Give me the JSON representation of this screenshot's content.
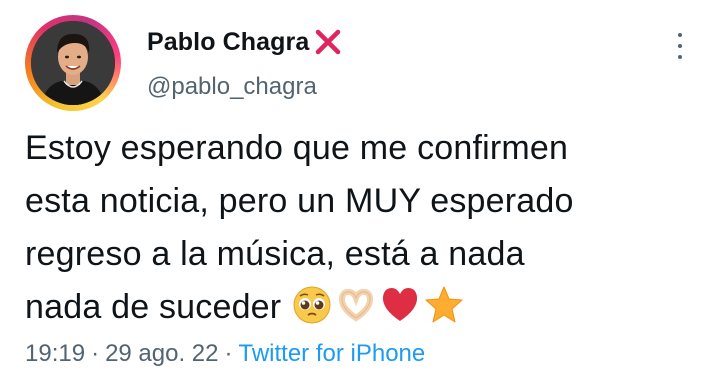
{
  "author": {
    "display_name": "Pablo Chagra",
    "handle": "@pablo_chagra",
    "badge_icon": "red-x-icon",
    "avatar_ring_colors": [
      "#f4c430",
      "#f57c1f",
      "#e1306c",
      "#c13584"
    ]
  },
  "tweet": {
    "lines": [
      "Estoy esperando que me confirmen",
      "esta noticia, pero un MUY esperado",
      "regreso a la música, está a nada",
      "nada de suceder"
    ],
    "emojis": [
      "pleading-face-emoji",
      "heart-hands-emoji",
      "red-heart-emoji",
      "star-emoji"
    ]
  },
  "meta": {
    "time": "19:19",
    "separator": "·",
    "date": "29 ago. 22",
    "source": "Twitter for iPhone"
  },
  "colors": {
    "text": "#0f1419",
    "secondary": "#536471",
    "link": "#1d9bf0",
    "badge": "#e0245e"
  }
}
